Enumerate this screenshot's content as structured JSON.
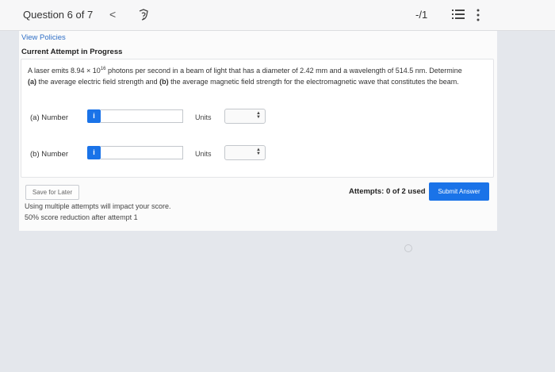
{
  "header": {
    "question_title": "Question 6 of 7",
    "back_glyph": "<",
    "score": "-/1",
    "icons": [
      "chevron-left-icon",
      "question-icon",
      "list-icon",
      "kebab-menu-icon"
    ]
  },
  "policies_link": "View Policies",
  "attempt_title": "Current Attempt in Progress",
  "question": {
    "text_before_exponent": "A laser emits 8.94 × 10",
    "exponent": "16",
    "text_after_exponent": " photons per second in a beam of light that has a diameter of 2.42 mm and a wavelength of 514.5 nm. Determine ",
    "part_a_marker": "(a)",
    "mid_text": " the average electric field strength and ",
    "part_b_marker": "(b)",
    "end_text": " the average magnetic field strength for the electromagnetic wave that constitutes the beam."
  },
  "answers": [
    {
      "label": "(a) Number",
      "info_glyph": "i",
      "value": "",
      "units_label": "Units",
      "units_value": ""
    },
    {
      "label": "(b) Number",
      "info_glyph": "i",
      "value": "",
      "units_label": "Units",
      "units_value": ""
    }
  ],
  "footer": {
    "save_label": "Save for Later",
    "note_1": "Using multiple attempts will impact your score.",
    "note_2": "50% score reduction after attempt 1",
    "attempts_text": "Attempts: 0 of 2 used",
    "submit_label": "Submit Answer"
  },
  "colors": {
    "accent": "#1a73e8",
    "link": "#2f6fc6",
    "background": "#e4e7ec"
  }
}
